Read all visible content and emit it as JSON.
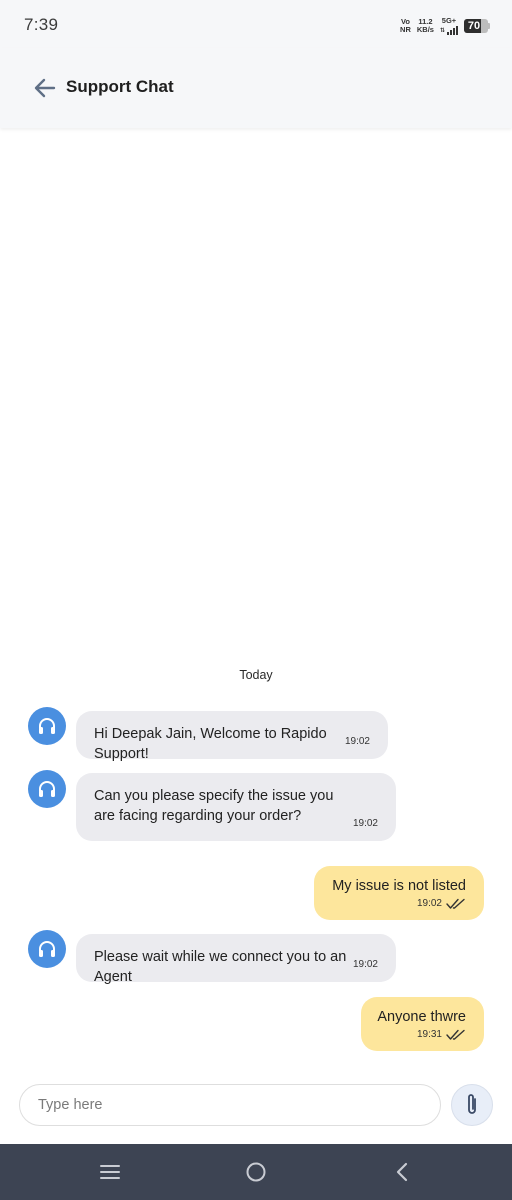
{
  "status_bar": {
    "time": "7:39",
    "network_top": "Vo",
    "network_bottom": "NR",
    "speed_value": "11.2",
    "speed_unit": "KB/s",
    "signal_label": "5G+",
    "battery_level": "70",
    "battery_fraction": 0.7
  },
  "header": {
    "title": "Support Chat",
    "back_icon": "arrow-left-icon"
  },
  "chat": {
    "day_label": "Today",
    "messages": [
      {
        "direction": "incoming",
        "text": "Hi Deepak Jain, Welcome to Rapido Support!",
        "time": "19:02"
      },
      {
        "direction": "incoming",
        "text": "Can you please specify the issue you are facing regarding your order?",
        "time": "19:02"
      },
      {
        "direction": "outgoing",
        "text": "My issue is not listed",
        "time": "19:02",
        "status": "read"
      },
      {
        "direction": "incoming",
        "text": "Please wait while we connect you to an Agent",
        "time": "19:02"
      },
      {
        "direction": "outgoing",
        "text": "Anyone thwre",
        "time": "19:31",
        "status": "read"
      }
    ]
  },
  "composer": {
    "placeholder": "Type here",
    "value": "",
    "attach_icon": "paperclip-icon"
  },
  "navigation": {
    "menu_icon": "menu-icon",
    "home_icon": "home-circle-icon",
    "back_icon": "back-chevron-icon"
  },
  "colors": {
    "agent_avatar": "#4a8fe0",
    "incoming_bubble": "#ebebef",
    "outgoing_bubble": "#fde69c",
    "nav_bar": "#3d4453",
    "header_bg": "#f6f7f9"
  }
}
